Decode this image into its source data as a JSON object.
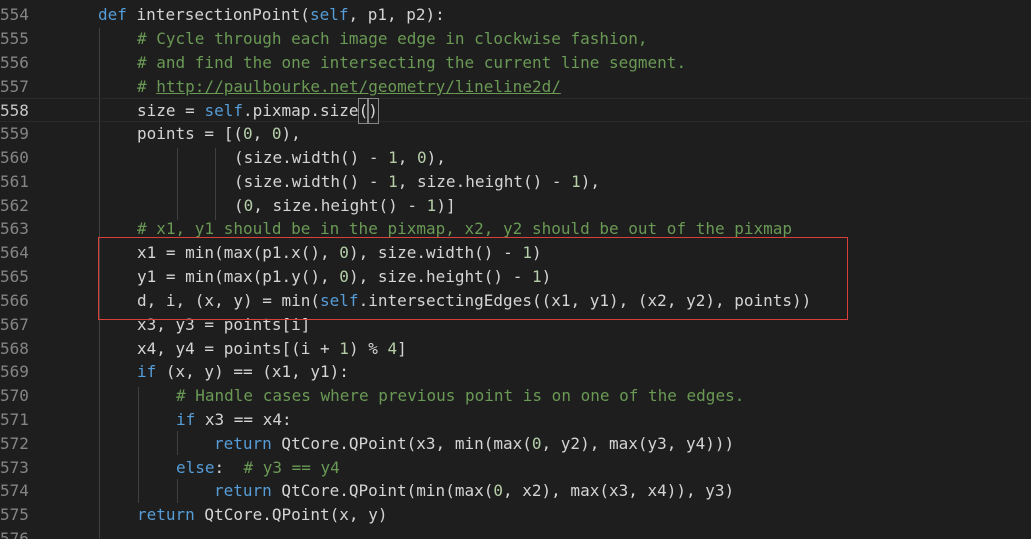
{
  "editor": {
    "language": "python",
    "current_line": "558",
    "colors": {
      "background": "#1e1e1e",
      "keyword": "#569cd6",
      "comment": "#6a9955",
      "number": "#b5cea8",
      "text": "#d4d4d4",
      "line_number": "#858585",
      "highlight_box": "#d9403a"
    },
    "lines": [
      {
        "n": "554"
      },
      {
        "n": "555"
      },
      {
        "n": "556"
      },
      {
        "n": "557"
      },
      {
        "n": "558"
      },
      {
        "n": "559"
      },
      {
        "n": "560"
      },
      {
        "n": "561"
      },
      {
        "n": "562"
      },
      {
        "n": "563"
      },
      {
        "n": "564"
      },
      {
        "n": "565"
      },
      {
        "n": "566"
      },
      {
        "n": "567"
      },
      {
        "n": "568"
      },
      {
        "n": "569"
      },
      {
        "n": "570"
      },
      {
        "n": "571"
      },
      {
        "n": "572"
      },
      {
        "n": "573"
      },
      {
        "n": "574"
      },
      {
        "n": "575"
      },
      {
        "n": "576"
      }
    ],
    "tokens": {
      "l554": [
        "def",
        " intersectionPoint(",
        "self",
        ", p1, p2):"
      ],
      "l555": "# Cycle through each image edge in clockwise fashion,",
      "l556": "# and find the one intersecting the current line segment.",
      "l557": [
        "# ",
        "http://paulbourke.net/geometry/lineline2d/"
      ],
      "l558": [
        "size = ",
        "self",
        ".pixmap.size",
        "(",
        ")"
      ],
      "l559": [
        "points = [(",
        "0",
        ", ",
        "0",
        "),"
      ],
      "l560": [
        "(size.width() - ",
        "1",
        ", ",
        "0",
        "),"
      ],
      "l561": [
        "(size.width() - ",
        "1",
        ", size.height() - ",
        "1",
        "),"
      ],
      "l562": [
        "(",
        "0",
        ", size.height() - ",
        "1",
        ")]"
      ],
      "l563": "# x1, y1 should be in the pixmap, x2, y2 should be out of the pixmap",
      "l564": [
        "x1 = min(max(p1.x(), ",
        "0",
        "), size.width() - ",
        "1",
        ")"
      ],
      "l565": [
        "y1 = min(max(p1.y(), ",
        "0",
        "), size.height() - ",
        "1",
        ")"
      ],
      "l566": [
        "d, i, (x, y) = min(",
        "self",
        ".intersectingEdges((x1, y1), (x2, y2), points))"
      ],
      "l567": "x3, y3 = points[i]",
      "l568": [
        "x4, y4 = points[(i + ",
        "1",
        ") % ",
        "4",
        "]"
      ],
      "l569": [
        "if",
        " (x, y) == (x1, y1):"
      ],
      "l570": "# Handle cases where previous point is on one of the edges.",
      "l571": [
        "if",
        " x3 == x4:"
      ],
      "l572": [
        "return",
        " QtCore.QPoint(x3, min(max(",
        "0",
        ", y2), max(y3, y4)))"
      ],
      "l573": [
        "else",
        ":  ",
        "# y3 == y4"
      ],
      "l574": [
        "return",
        " QtCore.QPoint(min(max(",
        "0",
        ", x2), max(x3, x4)), y3)"
      ],
      "l575": [
        "return",
        " QtCore.QPoint(x, y)"
      ]
    }
  }
}
